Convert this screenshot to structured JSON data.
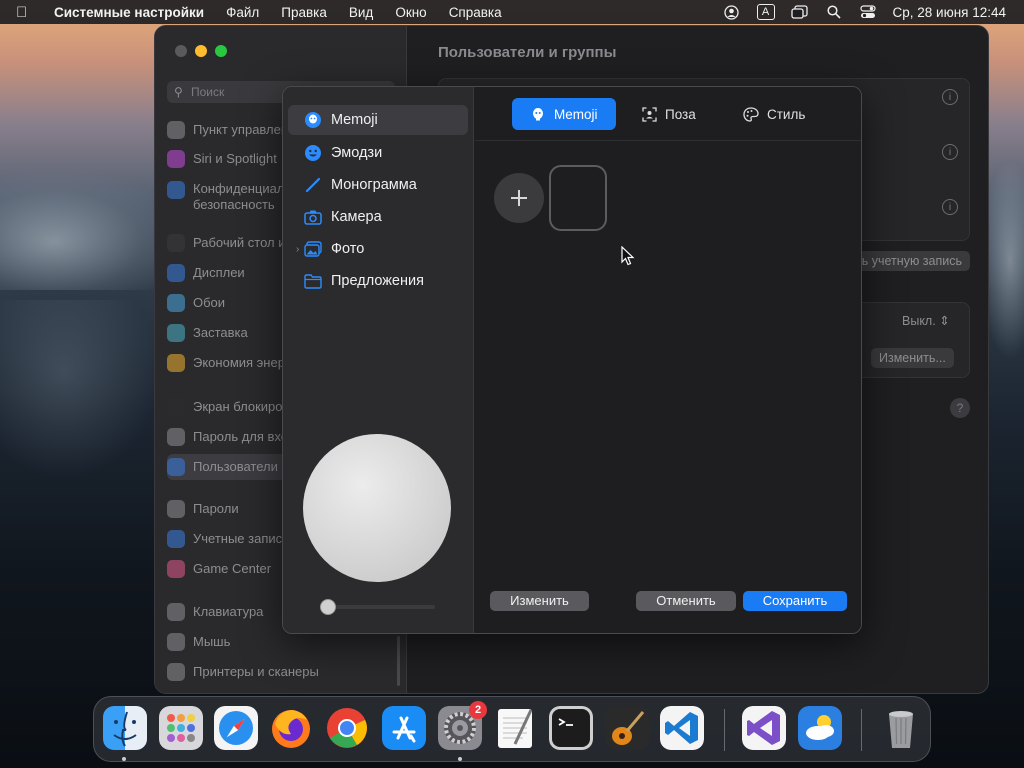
{
  "menubar": {
    "app_name": "Системные настройки",
    "items": [
      "Файл",
      "Правка",
      "Вид",
      "Окно",
      "Справка"
    ],
    "input_indicator": "A",
    "clock": "Ср, 28 июня  12:44"
  },
  "settings": {
    "search_placeholder": "Поиск",
    "title": "Пользователи и группы",
    "sidebar": [
      {
        "label": "Пункт управления",
        "color": "#8e8e93"
      },
      {
        "label": "Siri и Spotlight",
        "color": "#c74ae0"
      },
      {
        "label": "Конфиденциальность и безопасность",
        "color": "#3a7be0"
      },
      {
        "label": "Рабочий стол и Dock",
        "color": "#3a3a3c"
      },
      {
        "label": "Дисплеи",
        "color": "#3a7be0"
      },
      {
        "label": "Обои",
        "color": "#4aa8e0"
      },
      {
        "label": "Заставка",
        "color": "#4ab0c8"
      },
      {
        "label": "Экономия энергии",
        "color": "#f0b030"
      },
      {
        "label": "Экран блокировки",
        "color": "#2c2c2e"
      },
      {
        "label": "Пароль для входа",
        "color": "#8e8e93"
      },
      {
        "label": "Пользователи и группы",
        "color": "#3a7be0"
      },
      {
        "label": "Пароли",
        "color": "#8e8e93"
      },
      {
        "label": "Учетные записи интернета",
        "color": "#3a7be0"
      },
      {
        "label": "Game Center",
        "color": "#e05a8a"
      },
      {
        "label": "Клавиатура",
        "color": "#8e8e93"
      },
      {
        "label": "Мышь",
        "color": "#8e8e93"
      },
      {
        "label": "Принтеры и сканеры",
        "color": "#8e8e93"
      }
    ],
    "add_account_button": "Добавить учетную запись...",
    "guest_value": "Выкл.",
    "edit_button": "Изменить...",
    "help": "?"
  },
  "dialog": {
    "categories": [
      "Memoji",
      "Эмодзи",
      "Монограмма",
      "Камера",
      "Фото",
      "Предложения"
    ],
    "tabs": [
      "Memoji",
      "Поза",
      "Стиль"
    ],
    "edit_button": "Изменить",
    "cancel_button": "Отменить",
    "save_button": "Сохранить",
    "size_slider_level": 0
  },
  "dock": {
    "apps": [
      "Finder",
      "Launchpad",
      "Safari",
      "Firefox",
      "Chrome",
      "App Store",
      "Системные настройки",
      "TextEdit",
      "Терминал",
      "GarageBand",
      "Visual Studio Code",
      "Visual Studio",
      "Погода",
      "Корзина"
    ],
    "badge": "2"
  },
  "colors": {
    "accent": "#1a7cf5",
    "window_bg": "#1f1f22",
    "badge": "#e8383d"
  }
}
